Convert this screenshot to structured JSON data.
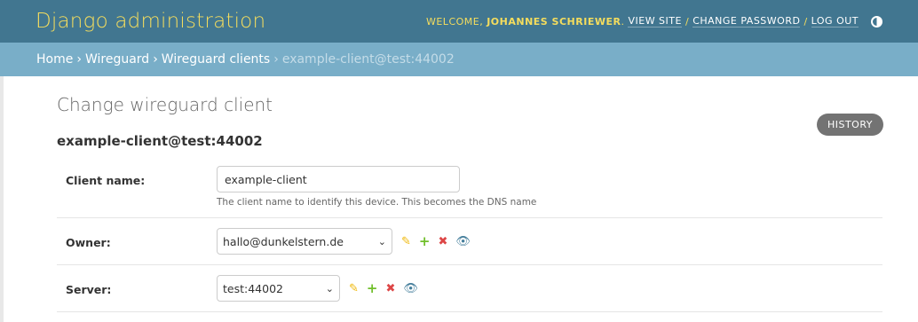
{
  "header": {
    "title": "Django administration",
    "welcome": "Welcome,",
    "username": "Johannes Schriewer",
    "view_site": "View site",
    "change_password": "Change password",
    "log_out": "Log out",
    "sep": "/"
  },
  "breadcrumbs": {
    "home": "Home",
    "app": "Wireguard",
    "model": "Wireguard clients",
    "current": "example-client@test:44002",
    "arrow": "›"
  },
  "page": {
    "title": "Change wireguard client",
    "object_title": "example-client@test:44002",
    "history_label": "History"
  },
  "fields": {
    "client_name": {
      "label": "Client name:",
      "value": "example-client",
      "help": "The client name to identify this device. This becomes the DNS name"
    },
    "owner": {
      "label": "Owner:",
      "value": "hallo@dunkelstern.de"
    },
    "server": {
      "label": "Server:",
      "value": "test:44002"
    }
  },
  "icons": {
    "pencil": "✎",
    "plus": "+",
    "cross": "✖",
    "eye": "👁",
    "chevron": "⌄"
  }
}
